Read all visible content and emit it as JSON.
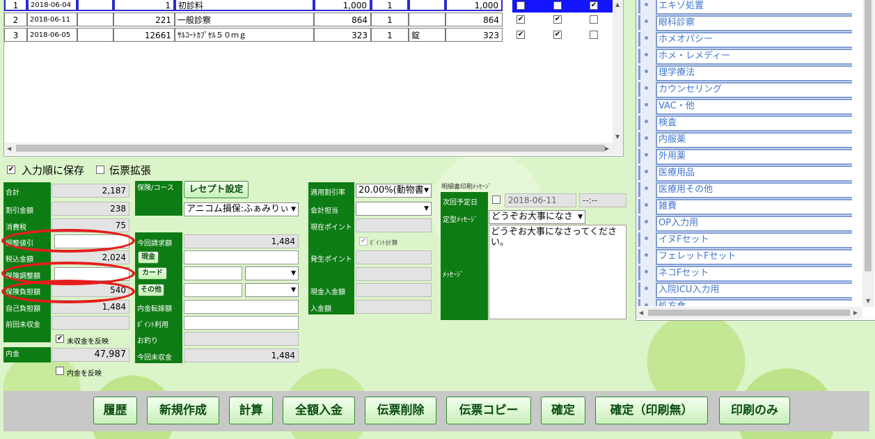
{
  "table": {
    "rows": [
      {
        "no": "1",
        "date": "2018-06-04",
        "code": "1",
        "name": "初診料",
        "price": "1,000",
        "qty": "1",
        "unit": "",
        "amount": "1,000",
        "c1": false,
        "c2": false,
        "c3": true
      },
      {
        "no": "2",
        "date": "2018-06-11",
        "code": "221",
        "name": "一般診察",
        "price": "864",
        "qty": "1",
        "unit": "",
        "amount": "864",
        "c1": true,
        "c2": true,
        "c3": false
      },
      {
        "no": "3",
        "date": "2018-06-05",
        "code": "12661",
        "name": "ｻﾙｺｰﾄｶﾌﾟｾﾙ５０ｍｇ",
        "price": "323",
        "qty": "1",
        "unit": "錠",
        "amount": "323",
        "c1": true,
        "c2": true,
        "c3": false
      }
    ]
  },
  "options": {
    "save_order_label": "入力順に保存",
    "expand_label": "伝票拡張"
  },
  "summary": {
    "total_label": "合計",
    "total": "2,187",
    "discount_label": "割引金額",
    "discount": "238",
    "tax_label": "消費税",
    "tax": "75",
    "adjust_label": "調整値引",
    "adjust": "",
    "taxincl_label": "税込金額",
    "taxincl": "2,024",
    "ins_adjust_label": "保険調整額",
    "ins_adjust": "",
    "ins_burden_label": "保険負担額",
    "ins_burden": "540",
    "self_burden_label": "自己負担額",
    "self_burden": "1,484",
    "prev_unpaid_label": "前回未収金",
    "prev_unpaid": "",
    "reflect_unpaid_label": "未収金を反映",
    "deposit_label": "内金",
    "deposit": "47,987",
    "reflect_deposit_label": "内金を反映"
  },
  "insurance": {
    "label": "保険/コース",
    "receipt_button": "レセプト設定",
    "selected": "アニコム損保:ふぁみりぃ"
  },
  "billing": {
    "this_bill_label": "今回請求額",
    "this_bill": "1,484",
    "cash_label": "現金",
    "card_label": "カード",
    "other_label": "その他",
    "deposit_transfer_label": "内金転嫁額",
    "point_use_label": "ﾎﾟｲﾝﾄ利用",
    "change_label": "お釣り",
    "this_unpaid_label": "今回未収金",
    "this_unpaid": "1,484"
  },
  "rates": {
    "discount_rate_label": "適用割引率",
    "discount_rate": "20.00%(動物書",
    "accountant_label": "会計担当",
    "current_points_label": "現在ポイント",
    "point_calc_label": "ﾎﾟｲﾝﾄ計算",
    "earned_points_label": "発生ポイント",
    "cash_in_label": "現金入金額",
    "deposit_in_label": "入金額"
  },
  "message": {
    "title": "明細書印刷ﾒｯｾｰｼﾞ",
    "next_date_label": "次回予定日",
    "next_date": "2018-06-11",
    "next_time": "--:--",
    "template_label": "定型ﾒｯｾｰｼﾞ",
    "template_selected": "どうぞお大事になさ",
    "message_label": "ﾒｯｾｰｼﾞ",
    "message_text": "どうぞお大事になさってください。"
  },
  "menu": {
    "items": [
      "エキゾ処置",
      "眼科診察",
      "ホメオパシー",
      "ホメ・レメディー",
      "理学療法",
      "カウンセリング",
      "VAC・他",
      "検査",
      "内服薬",
      "外用薬",
      "医療用品",
      "医療用その他",
      "雑費",
      "OP入力用",
      "イヌFセット",
      "フェレットFセット",
      "ネコFセット",
      "入院ICU入力用",
      "処方食"
    ]
  },
  "toolbar": {
    "history": "履歴",
    "new": "新規作成",
    "calc": "計算",
    "full_payment": "全額入金",
    "delete_slip": "伝票削除",
    "copy_slip": "伝票コピー",
    "confirm": "確定",
    "confirm_noprint": "確定（印刷無）",
    "print_only": "印刷のみ"
  },
  "colors": {
    "label_green": "#0e7c14",
    "selection_blue": "#1414ff",
    "annotation_red": "#e51d1d",
    "menu_text": "#3f75d0"
  }
}
